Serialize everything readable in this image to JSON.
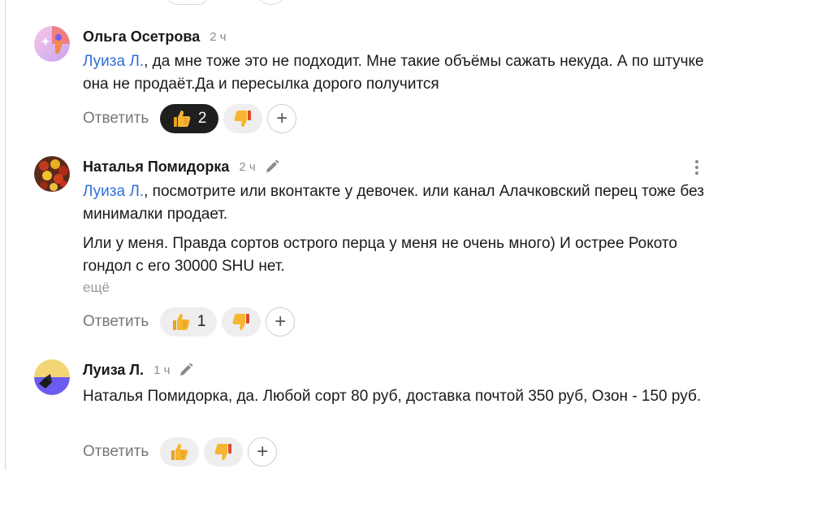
{
  "comments": [
    {
      "author": "Ольга Осетрова",
      "time": "2 ч",
      "mention": "Луиза Л.",
      "text_after_mention": ", да мне тоже это не подходит. Мне такие объёмы сажать некуда. А по штучке она не продаёт.Да и пересылка дорого получится",
      "reply_label": "Ответить",
      "like_count": "2",
      "dislike_count": ""
    },
    {
      "author": "Наталья Помидорка",
      "time": "2 ч",
      "mention": "Луиза Л.",
      "text_after_mention": ", посмотрите или вконтакте у девочек. или канал Алачковский перец тоже без минималки продает.",
      "paragraph2": "Или у меня. Правда сортов острого перца у меня не очень много) И острее Рокото гондол с его 30000 SHU нет.",
      "more_label": "ещё",
      "reply_label": "Ответить",
      "like_count": "1",
      "dislike_count": ""
    },
    {
      "author": "Луиза Л.",
      "time": "1 ч",
      "text": "Наталья Помидорка, да. Любой сорт 80 руб, доставка почтой 350 руб, Озон - 150 руб.",
      "reply_label": "Ответить",
      "like_count": "",
      "dislike_count": ""
    }
  ],
  "colors": {
    "mention": "#2f6fd6",
    "active_reaction_bg": "#1f1f1f",
    "reaction_bg": "#eeeeee",
    "meta_text": "#8c8c8c"
  },
  "icons": {
    "like": "thumbs-up-icon",
    "dislike": "thumbs-down-icon",
    "add_reaction": "plus-icon",
    "edited": "pencil-icon",
    "menu": "kebab-menu-icon"
  }
}
